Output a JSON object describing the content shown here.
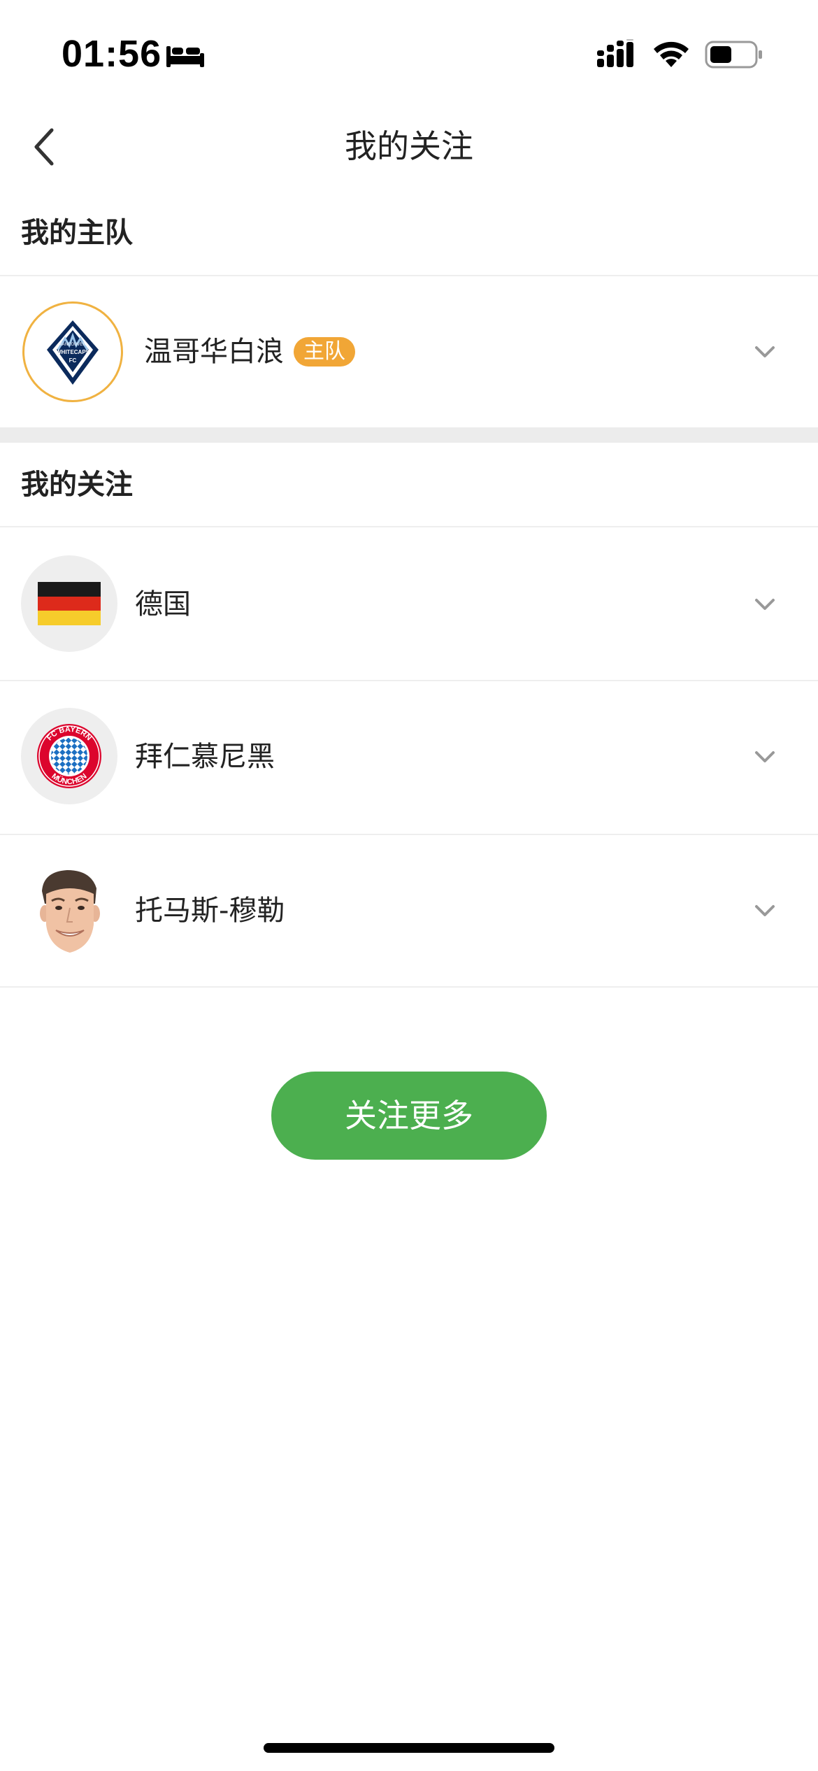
{
  "status_bar": {
    "time": "01:56",
    "icons": [
      "sleep-icon",
      "signal-icon",
      "wifi-icon",
      "battery-icon"
    ]
  },
  "nav": {
    "title": "我的关注",
    "back_icon": "chevron-left-icon"
  },
  "home_team_section": {
    "header": "我的主队",
    "team": {
      "name": "温哥华白浪",
      "badge": "主队",
      "logo_text_top": "VANCOUVER",
      "logo_text_main": "WHITECAPS",
      "logo_text_bottom": "FC"
    }
  },
  "follow_section": {
    "header": "我的关注",
    "items": [
      {
        "name": "德国",
        "avatar": "germany-flag-icon"
      },
      {
        "name": "拜仁慕尼黑",
        "avatar": "bayern-logo",
        "logo_text_top": "FC BAYERN",
        "logo_text_bottom": "MÜNCHEN"
      },
      {
        "name": "托马斯-穆勒",
        "avatar": "player-photo"
      }
    ]
  },
  "follow_more_button": "关注更多",
  "colors": {
    "accent_green": "#4caf4f",
    "badge_orange": "#f1a636",
    "home_team_ring": "#f0b241",
    "separator_band": "#ececec"
  }
}
